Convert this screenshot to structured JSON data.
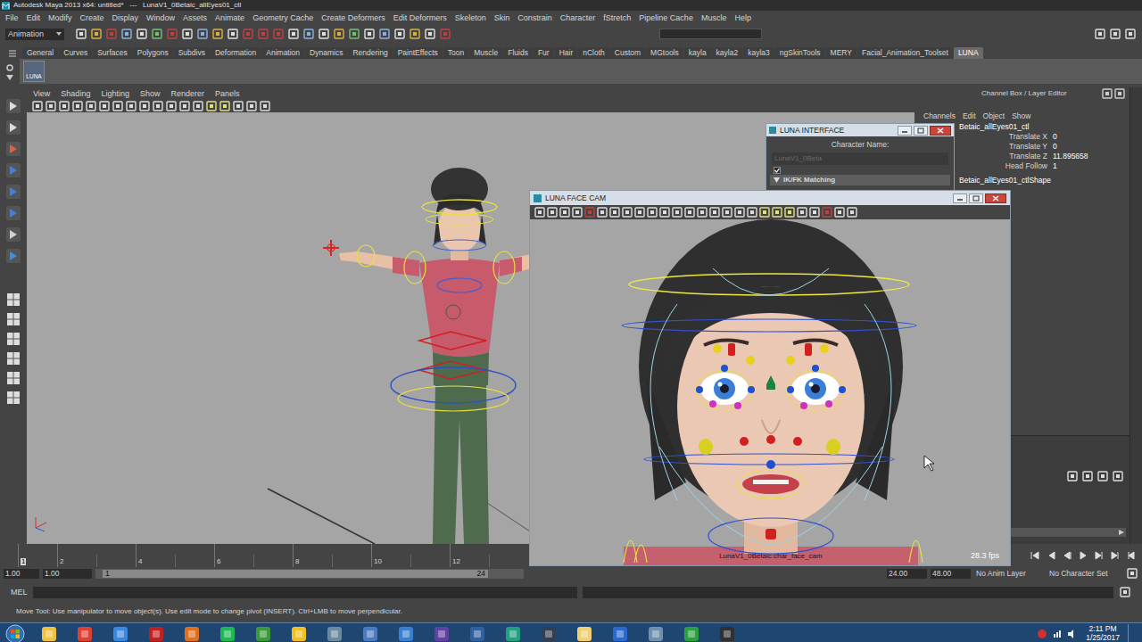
{
  "window": {
    "title": "Autodesk Maya 2013 x64: untitled*   ---   LunaV1_0Betaic_allEyes01_ctl"
  },
  "menu": [
    "File",
    "Edit",
    "Modify",
    "Create",
    "Display",
    "Window",
    "Assets",
    "Animate",
    "Geometry Cache",
    "Create Deformers",
    "Edit Deformers",
    "Skeleton",
    "Skin",
    "Constrain",
    "Character",
    "fStretch",
    "Pipeline Cache",
    "Muscle",
    "Help"
  ],
  "status_line": {
    "mode": "Animation"
  },
  "shelf": {
    "tabs": [
      {
        "label": "General",
        "selected": false
      },
      {
        "label": "Curves",
        "selected": false
      },
      {
        "label": "Surfaces",
        "selected": false
      },
      {
        "label": "Polygons",
        "selected": false
      },
      {
        "label": "Subdivs",
        "selected": false
      },
      {
        "label": "Deformation",
        "selected": false
      },
      {
        "label": "Animation",
        "selected": false
      },
      {
        "label": "Dynamics",
        "selected": false
      },
      {
        "label": "Rendering",
        "selected": false
      },
      {
        "label": "PaintEffects",
        "selected": false
      },
      {
        "label": "Toon",
        "selected": false
      },
      {
        "label": "Muscle",
        "selected": false
      },
      {
        "label": "Fluids",
        "selected": false
      },
      {
        "label": "Fur",
        "selected": false
      },
      {
        "label": "Hair",
        "selected": false
      },
      {
        "label": "nCloth",
        "selected": false
      },
      {
        "label": "Custom",
        "selected": false
      },
      {
        "label": "MGtools",
        "selected": false
      },
      {
        "label": "kayla",
        "selected": false
      },
      {
        "label": "kayla2",
        "selected": false
      },
      {
        "label": "kayla3",
        "selected": false
      },
      {
        "label": "ngSkinTools",
        "selected": false
      },
      {
        "label": "MERY",
        "selected": false
      },
      {
        "label": "Facial_Animation_Toolset",
        "selected": false
      },
      {
        "label": "LUNA",
        "selected": true
      }
    ],
    "items": [
      {
        "label": "LUNA"
      }
    ]
  },
  "viewport": {
    "menu": [
      "View",
      "Shading",
      "Lighting",
      "Show",
      "Renderer",
      "Panels"
    ]
  },
  "channel_box": {
    "title": "Channel Box / Layer Editor",
    "menu": [
      "Channels",
      "Edit",
      "Object",
      "Show"
    ],
    "object": "Betaic_allEyes01_ctl",
    "attributes": [
      {
        "name": "Translate X",
        "value": "0"
      },
      {
        "name": "Translate Y",
        "value": "0"
      },
      {
        "name": "Translate Z",
        "value": "11.895658"
      },
      {
        "name": "Head Follow",
        "value": "1"
      }
    ],
    "shape": "Betaic_allEyes01_ctlShape"
  },
  "luna_interface": {
    "title": "LUNA INTERFACE",
    "name_label": "Character Name:",
    "name_value": "LunaV1_0Beta",
    "option_checked": true,
    "section": {
      "label": "IK/FK Matching",
      "expanded": true
    }
  },
  "face_cam": {
    "title": "LUNA FACE CAM",
    "camera": "LunaV1_0Betaic:char_face_cam",
    "fps": "28.3 fps"
  },
  "timeline": {
    "ticks": [
      {
        "label": "1",
        "current": true
      },
      {
        "label": "2",
        "current": false
      },
      {
        "label": "4",
        "current": false
      },
      {
        "label": "6",
        "current": false
      },
      {
        "label": "8",
        "current": false
      },
      {
        "label": "10",
        "current": false
      },
      {
        "label": "12",
        "current": false
      }
    ]
  },
  "range": {
    "start": "1.00",
    "range_start": "1.00",
    "slider_start": "1",
    "slider_end": "24",
    "range_end": "24.00",
    "end": "48.00",
    "anim_layer": "No Anim Layer",
    "character_set": "No Character Set"
  },
  "command_line": {
    "language": "MEL"
  },
  "help_line": {
    "text": "Move Tool: Use manipulator to move object(s). Use edit mode to change pivot (INSERT). Ctrl+LMB to move perpendicular."
  },
  "taskbar": {
    "time": "2:11 PM",
    "date": "1/25/2017"
  }
}
